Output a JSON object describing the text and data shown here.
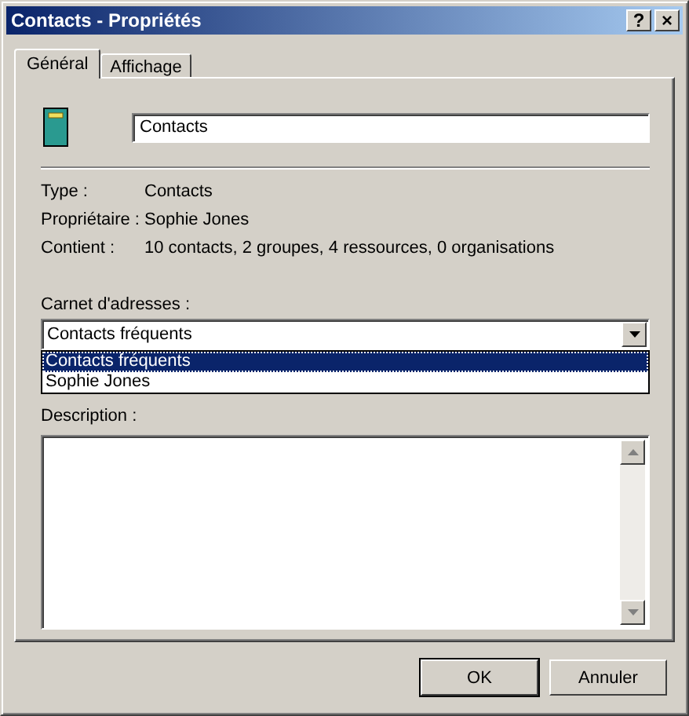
{
  "window": {
    "title": "Contacts - Propriétés",
    "help_button": "?",
    "close_button": "×"
  },
  "tabs": [
    {
      "label": "Général",
      "selected": true
    },
    {
      "label": "Affichage",
      "selected": false
    }
  ],
  "name_field": {
    "value": "Contacts"
  },
  "info": [
    {
      "label": "Type :",
      "value": "Contacts"
    },
    {
      "label": "Propriétaire :",
      "value": "Sophie Jones"
    },
    {
      "label": "Contient :",
      "value": "10 contacts, 2 groupes, 4 ressources, 0 organisations"
    }
  ],
  "address_book": {
    "label": "Carnet d'adresses :",
    "value": "Contacts fréquents",
    "expanded": true,
    "options": [
      {
        "label": "Contacts fréquents",
        "selected": true
      },
      {
        "label": "Sophie Jones",
        "selected": false
      }
    ]
  },
  "description": {
    "label": "Description :"
  },
  "buttons": [
    {
      "label": "OK",
      "default": true
    },
    {
      "label": "Annuler",
      "default": false
    }
  ]
}
